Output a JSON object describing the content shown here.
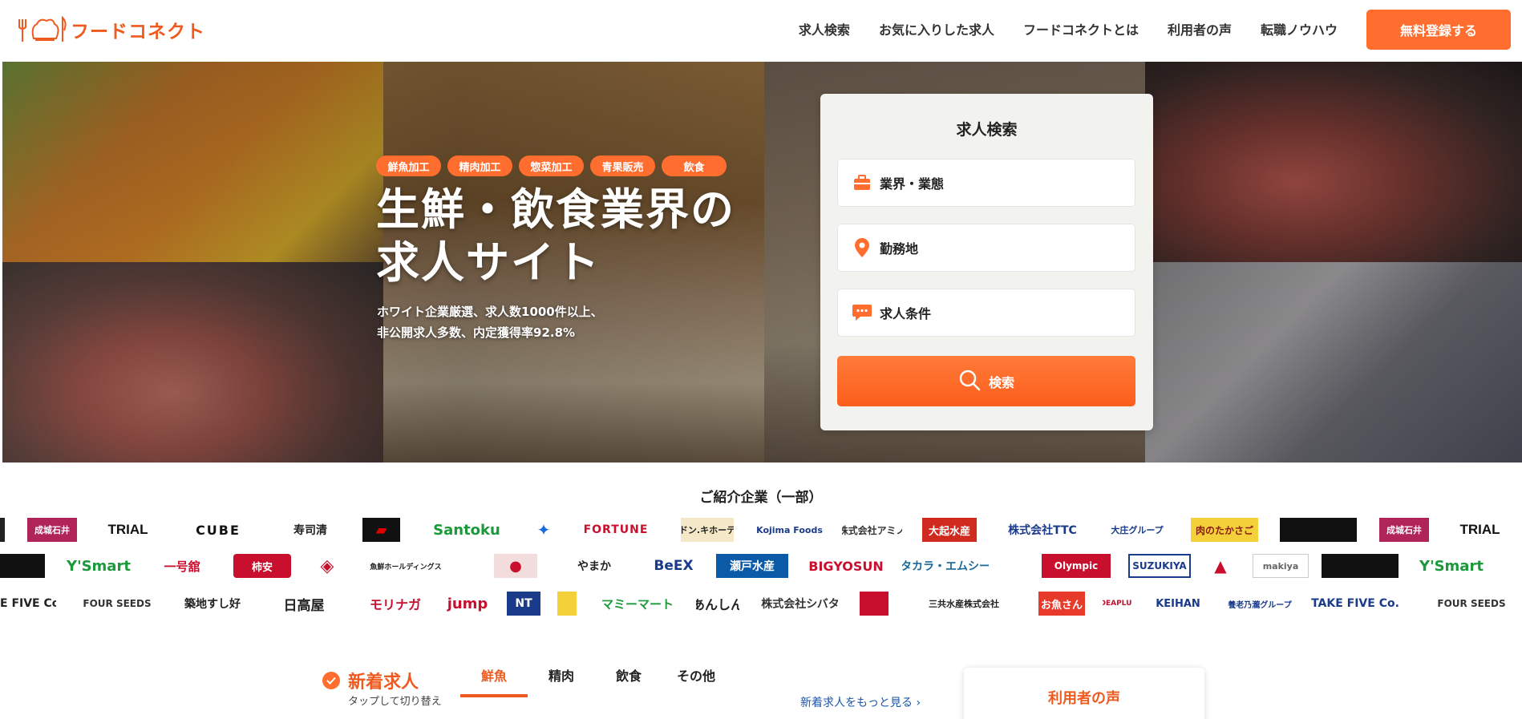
{
  "header": {
    "logo_text": "フードコネクト",
    "nav": [
      "求人検索",
      "お気に入りした求人",
      "フードコネクトとは",
      "利用者の声",
      "転職ノウハウ"
    ],
    "cta_label": "無料登録する"
  },
  "hero": {
    "tags": [
      "鮮魚加工",
      "精肉加工",
      "惣菜加工",
      "青果販売",
      "飲食"
    ],
    "title_line1": "生鮮・飲食業界の",
    "title_line2": "求人サイト",
    "subtitle_line1": "ホワイト企業厳選、求人数1000件以上、",
    "subtitle_line2": "非公開求人多数、内定獲得率92.8%"
  },
  "search": {
    "title": "求人検索",
    "field_industry": "業界・業態",
    "field_location": "勤務地",
    "field_conditions": "求人条件",
    "button_label": "検索"
  },
  "companies": {
    "title": "ご紹介企業（一部）",
    "row1": [
      "成城石井",
      "TRIAL",
      "CUBE",
      "寿司清",
      "",
      "Santoku",
      "",
      "FORTUNE",
      "ドン.キホーテ",
      "Kojima Foods",
      "株式会社アミノ",
      "大起水産",
      "株式会社TTC",
      "大庄グループ",
      "肉のたかさご",
      "",
      "成城石井",
      "TRIAL"
    ],
    "row2": [
      "",
      "Y'Smart",
      "一号舘",
      "柿安",
      "",
      "魚鮮ホールディングス",
      "",
      "やまか",
      "BeEX",
      "瀬戸水産",
      "BIGYOSUN",
      "タカラ・エムシー",
      "Olympic",
      "SUZUKIYA",
      "",
      "makiya",
      "",
      "Y'Smart"
    ],
    "row3": [
      "E FIVE Co.",
      "FOUR SEEDS",
      "築地すし好",
      "日高屋",
      "モリナガ",
      "jump",
      "NT",
      "",
      "マミーマート",
      "あんしん",
      "株式会社シバタ",
      "",
      "三共水産株式会社",
      "お魚さん",
      "IDEAPLUS",
      "KEIHAN",
      "養老乃瀧グループ",
      "TAKE FIVE Co.",
      "FOUR SEEDS"
    ]
  },
  "new_jobs": {
    "title": "新着求人",
    "hint": "タップして切り替え",
    "tabs": [
      "鮮魚",
      "精肉",
      "飲食",
      "その他"
    ],
    "more_link": "新着求人をもっと見る ›"
  },
  "voice": {
    "title": "利用者の声"
  },
  "colors": {
    "accent": "#ff6e2f",
    "brand_text": "#ef5b1e",
    "link": "#1a56a8"
  }
}
